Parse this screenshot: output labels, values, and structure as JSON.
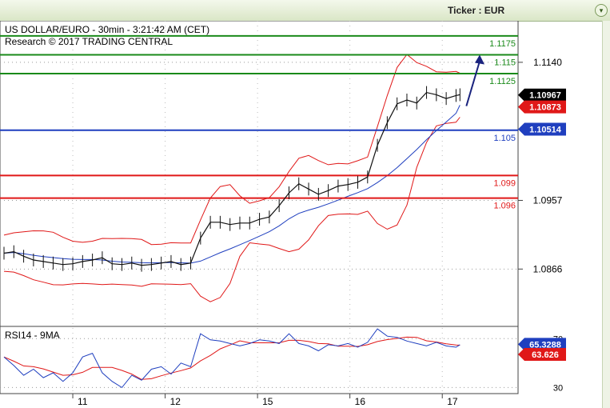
{
  "header": {
    "ticker": "Ticker : EUR",
    "expand_icon": "chevron-down-icon"
  },
  "chart_data": {
    "type": "line",
    "title": "US DOLLAR/EURO - 30min - 3:21:42 AM (CET)",
    "subtitle": "Research © 2017 TRADING CENTRAL",
    "x_ticks": [
      "11",
      "12",
      "15",
      "16",
      "17"
    ],
    "y_ticks": [
      "1.1140",
      "1.0957",
      "1.0866"
    ],
    "ylim": [
      1.079,
      1.1195
    ],
    "levels": [
      {
        "label": "1.1175",
        "value": 1.1175,
        "color": "#1a8a1a"
      },
      {
        "label": "1.115",
        "value": 1.115,
        "color": "#1a8a1a"
      },
      {
        "label": "1.1125",
        "value": 1.1125,
        "color": "#1a8a1a"
      },
      {
        "label": "1.105",
        "value": 1.105,
        "color": "#1f3fbf"
      },
      {
        "label": "1.099",
        "value": 1.099,
        "color": "#e01818"
      },
      {
        "label": "1.096",
        "value": 1.096,
        "color": "#e01818"
      }
    ],
    "current_price": {
      "label": "1.10967",
      "value": 1.10967,
      "color": "#000000"
    },
    "secondary_price": {
      "label": "1.10873",
      "value": 1.10873,
      "color": "#e01818"
    },
    "pivot_price": {
      "label": "1.10514",
      "value": 1.10514,
      "color": "#1f3fbf"
    },
    "price_series": [
      [
        0,
        1.0887
      ],
      [
        5,
        1.0889
      ],
      [
        10,
        1.0883
      ],
      [
        15,
        1.0878
      ],
      [
        20,
        1.0876
      ],
      [
        25,
        1.0874
      ],
      [
        30,
        1.0872
      ],
      [
        35,
        1.0873
      ],
      [
        40,
        1.0876
      ],
      [
        45,
        1.0878
      ],
      [
        50,
        1.0881
      ],
      [
        55,
        1.0873
      ],
      [
        60,
        1.0872
      ],
      [
        65,
        1.0874
      ],
      [
        70,
        1.0871
      ],
      [
        75,
        1.0872
      ],
      [
        80,
        1.0874
      ],
      [
        85,
        1.0876
      ],
      [
        90,
        1.0872
      ],
      [
        95,
        1.0874
      ],
      [
        100,
        1.0907
      ],
      [
        105,
        1.0928
      ],
      [
        110,
        1.0928
      ],
      [
        115,
        1.0925
      ],
      [
        120,
        1.0927
      ],
      [
        125,
        1.0927
      ],
      [
        130,
        1.0932
      ],
      [
        135,
        1.0935
      ],
      [
        140,
        1.095
      ],
      [
        145,
        1.0967
      ],
      [
        150,
        1.0979
      ],
      [
        155,
        1.0972
      ],
      [
        160,
        1.0965
      ],
      [
        165,
        1.097
      ],
      [
        170,
        1.0976
      ],
      [
        175,
        1.0978
      ],
      [
        180,
        1.0981
      ],
      [
        185,
        1.0988
      ],
      [
        190,
        1.103
      ],
      [
        195,
        1.106
      ],
      [
        200,
        1.1085
      ],
      [
        205,
        1.109
      ],
      [
        210,
        1.1086
      ],
      [
        215,
        1.11
      ],
      [
        220,
        1.1097
      ],
      [
        225,
        1.1092
      ],
      [
        230,
        1.1096
      ],
      [
        232,
        1.1097
      ]
    ],
    "forecast": [
      [
        232,
        1.1082
      ],
      [
        240,
        1.115
      ]
    ],
    "rsi": {
      "title": "RSI14 - 9MA",
      "ylim": [
        25,
        80
      ],
      "y_ticks": [
        "70",
        "30"
      ],
      "current": {
        "label": "65.3288",
        "value": 65.3288,
        "color": "#1f3fbf"
      },
      "ma": {
        "label": "63.626",
        "value": 63.626,
        "color": "#e01818"
      },
      "values": [
        [
          0,
          55
        ],
        [
          5,
          48
        ],
        [
          10,
          40
        ],
        [
          15,
          45
        ],
        [
          20,
          38
        ],
        [
          25,
          42
        ],
        [
          30,
          35
        ],
        [
          35,
          42
        ],
        [
          40,
          55
        ],
        [
          45,
          58
        ],
        [
          50,
          42
        ],
        [
          55,
          35
        ],
        [
          60,
          30
        ],
        [
          65,
          40
        ],
        [
          70,
          36
        ],
        [
          75,
          45
        ],
        [
          80,
          47
        ],
        [
          85,
          41
        ],
        [
          90,
          50
        ],
        [
          95,
          47
        ],
        [
          100,
          74
        ],
        [
          105,
          69
        ],
        [
          110,
          68
        ],
        [
          115,
          66
        ],
        [
          120,
          64
        ],
        [
          125,
          66
        ],
        [
          130,
          69
        ],
        [
          135,
          68
        ],
        [
          140,
          66
        ],
        [
          145,
          74
        ],
        [
          150,
          66
        ],
        [
          155,
          64
        ],
        [
          160,
          60
        ],
        [
          165,
          65
        ],
        [
          170,
          64
        ],
        [
          175,
          66
        ],
        [
          180,
          63
        ],
        [
          185,
          67
        ],
        [
          190,
          78
        ],
        [
          195,
          72
        ],
        [
          200,
          71
        ],
        [
          205,
          68
        ],
        [
          210,
          66
        ],
        [
          215,
          64
        ],
        [
          220,
          67
        ],
        [
          225,
          64
        ],
        [
          230,
          63
        ],
        [
          232,
          65
        ]
      ]
    }
  }
}
